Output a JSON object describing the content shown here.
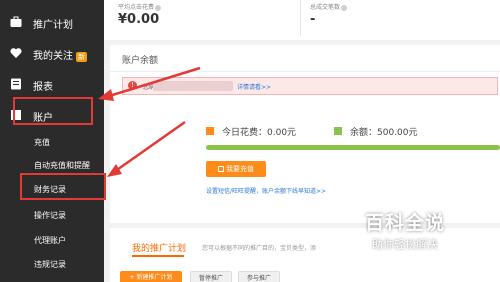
{
  "sidebar": {
    "items": [
      {
        "label": "推广计划",
        "icon": "briefcase-icon"
      },
      {
        "label": "我的关注",
        "icon": "heart-icon",
        "badge": "新"
      },
      {
        "label": "报表",
        "icon": "report-icon"
      },
      {
        "label": "账户",
        "icon": "account-icon"
      }
    ],
    "sub_items": [
      "充值",
      "自动充值和提醒",
      "财务记录",
      "操作记录",
      "代理账户",
      "违规记录"
    ]
  },
  "stats": {
    "avg_click_label": "平均点击花费",
    "avg_click_value": "¥0.00",
    "total_deals_label": "总成交笔数",
    "total_deals_value": "-"
  },
  "balance": {
    "title": "账户余额",
    "alert_text": "您绑",
    "alert_link": "详情请看>>",
    "today_label": "今日花费：",
    "today_value": "0.00元",
    "balance_label": "余额：",
    "balance_value": "500.00元",
    "balance_fraction": 1.0,
    "recharge_button": "我要充值",
    "settings_link": "设置短信/旺旺提醒，账户余额下线早知道>>"
  },
  "plans": {
    "tab": "我的推广计划",
    "desc": "您可以根据不同的推广目的，宝贝类型，添",
    "btn_new": "+ 新建推广计划",
    "btn_pause": "暂停推广",
    "btn_resume": "参与推广"
  },
  "watermark": {
    "title": "百科全说",
    "subtitle": "助你轻松解决"
  },
  "colors": {
    "accent": "#ff6a00",
    "highlight": "#e53935",
    "sidebar_bg": "#2b2b2b",
    "balance_green": "#8bc34a"
  }
}
